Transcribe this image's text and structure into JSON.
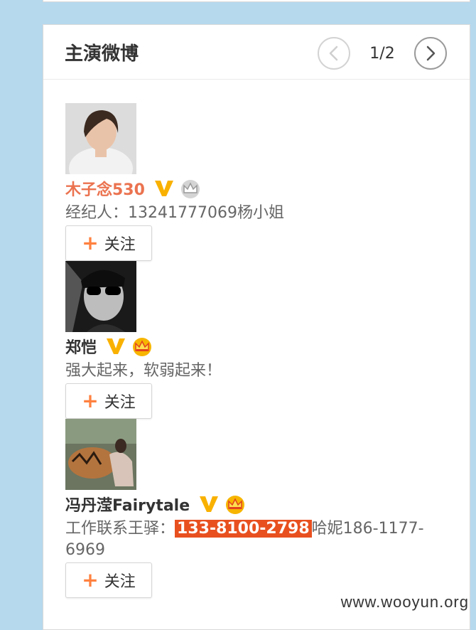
{
  "panel": {
    "title": "主演微博",
    "page_indicator": "1/2"
  },
  "users": [
    {
      "name": "木子念530",
      "name_color": "#eb7350",
      "desc": "经纪人：13241777069杨小姐",
      "follow_label": "关注",
      "crown_style": "grey"
    },
    {
      "name": "郑恺",
      "name_color": "#333333",
      "desc": "强大起来，软弱起来！",
      "follow_label": "关注",
      "crown_style": "gold"
    },
    {
      "name": "冯丹滢Fairytale",
      "name_color": "#333333",
      "desc_prefix": "工作联系王驿：",
      "desc_highlight": "133-8100-2798",
      "desc_suffix": "哈妮186-1177-6969",
      "follow_label": "关注",
      "crown_style": "gold"
    }
  ],
  "watermark": "www.wooyun.org",
  "colors": {
    "background": "#b6d9ee",
    "accent_orange": "#ff8140",
    "verified_v": "#f9b100",
    "highlight": "#e8501f"
  }
}
